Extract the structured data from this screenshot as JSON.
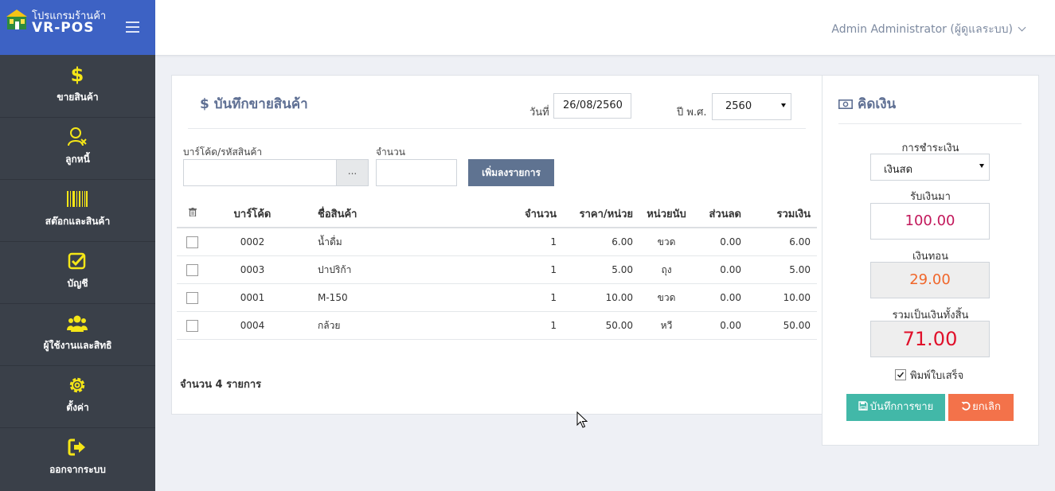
{
  "brand": {
    "line1": "โปรแกรมร้านค้า",
    "line2": "VR-POS"
  },
  "sidebar": {
    "items": [
      {
        "label": "ขายสินค้า",
        "icon": "dollar-icon"
      },
      {
        "label": "ลูกหนี้",
        "icon": "user-x-icon"
      },
      {
        "label": "สต๊อกและสินค้า",
        "icon": "barcode-icon"
      },
      {
        "label": "บัญชี",
        "icon": "check-square-icon"
      },
      {
        "label": "ผู้ใช้งานและสิทธิ",
        "icon": "users-icon"
      },
      {
        "label": "ตั้งค่า",
        "icon": "gear-icon"
      },
      {
        "label": "ออกจากระบบ",
        "icon": "sign-out-icon"
      }
    ]
  },
  "header": {
    "user": "Admin Administrator (ผู้ดูแลระบบ)"
  },
  "sale": {
    "title": "บันทึกขายสินค้า",
    "title_symbol": "$",
    "date_label": "วันที่",
    "date_value": "26/08/2560",
    "year_label": "ปี พ.ศ.",
    "year_value": "2560",
    "barcode_label": "บาร์โค้ด/รหัสสินค้า",
    "browse_label": "...",
    "qty_label": "จำนวน",
    "add_button": "เพิ่มลงรายการ",
    "columns": {
      "barcode": "บาร์โค้ด",
      "name": "ชื่อสินค้า",
      "qty": "จำนวน",
      "price": "ราคา/หน่วย",
      "unit": "หน่วยนับ",
      "discount": "ส่วนลด",
      "total": "รวมเงิน"
    },
    "rows": [
      {
        "barcode": "0002",
        "name": "น้ำดื่ม",
        "qty": "1",
        "price": "6.00",
        "unit": "ขวด",
        "discount": "0.00",
        "total": "6.00"
      },
      {
        "barcode": "0003",
        "name": "ปาปริก้า",
        "qty": "1",
        "price": "5.00",
        "unit": "ถุง",
        "discount": "0.00",
        "total": "5.00"
      },
      {
        "barcode": "0001",
        "name": "M-150",
        "qty": "1",
        "price": "10.00",
        "unit": "ขวด",
        "discount": "0.00",
        "total": "10.00"
      },
      {
        "barcode": "0004",
        "name": "กล้วย",
        "qty": "1",
        "price": "50.00",
        "unit": "หวี",
        "discount": "0.00",
        "total": "50.00"
      }
    ],
    "count_prefix": "จำนวน",
    "count_value": "4",
    "count_suffix": "รายการ"
  },
  "payment": {
    "title": "คิดเงิน",
    "method_label": "การชำระเงิน",
    "method_value": "เงินสด",
    "received_label": "รับเงินมา",
    "received_value": "100.00",
    "change_label": "เงินทอน",
    "change_value": "29.00",
    "total_label": "รวมเป็นเงินทั้งสิ้น",
    "total_value": "71.00",
    "print_label": "พิมพ์ใบเสร็จ",
    "print_checked": true,
    "save_button": "บันทึกการขาย",
    "cancel_button": "ยกเลิก"
  },
  "colors": {
    "brand": "#3d62c4",
    "sidebar": "#3a4049",
    "sidebar_icon": "#f5e617",
    "title": "#5e6f93",
    "add_button": "#5f7391",
    "save_button": "#42b8a8",
    "cancel_button": "#f3724a",
    "received": "#c2185b",
    "change": "#f0662a",
    "total": "#e0102a"
  }
}
